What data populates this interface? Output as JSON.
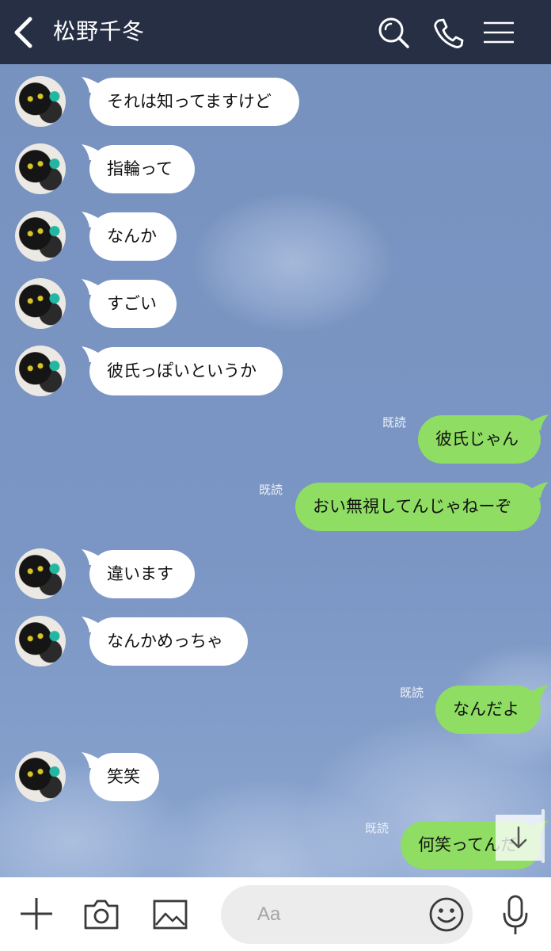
{
  "header": {
    "title": "松野千冬",
    "background": "#262f44"
  },
  "messages": [
    {
      "side": "in",
      "text": "それは知ってますけど"
    },
    {
      "side": "in",
      "text": "指輪って"
    },
    {
      "side": "in",
      "text": "なんか"
    },
    {
      "side": "in",
      "text": "すごい"
    },
    {
      "side": "in",
      "text": "彼氏っぽいというか"
    },
    {
      "side": "out",
      "text": "彼氏じゃん",
      "read": "既読"
    },
    {
      "side": "out",
      "text": "おい無視してんじゃねーぞ",
      "read": "既読"
    },
    {
      "side": "in",
      "text": "違います"
    },
    {
      "side": "in",
      "text": "なんかめっちゃ"
    },
    {
      "side": "out",
      "text": "なんだよ",
      "read": "既読"
    },
    {
      "side": "in",
      "text": "笑笑"
    },
    {
      "side": "out",
      "text": "何笑ってんだ",
      "read": "既読"
    }
  ],
  "input": {
    "placeholder": "Aa"
  },
  "colors": {
    "chat_background": "#7b95c2",
    "incoming_bubble": "#ffffff",
    "outgoing_bubble": "#8fdd62"
  },
  "icons": {
    "back": "chevron-left-icon",
    "search": "search-icon",
    "call": "phone-icon",
    "menu": "menu-icon",
    "plus": "plus-icon",
    "camera": "camera-icon",
    "image": "image-icon",
    "emoji": "emoji-icon",
    "mic": "microphone-icon",
    "scroll": "arrow-down-icon"
  }
}
